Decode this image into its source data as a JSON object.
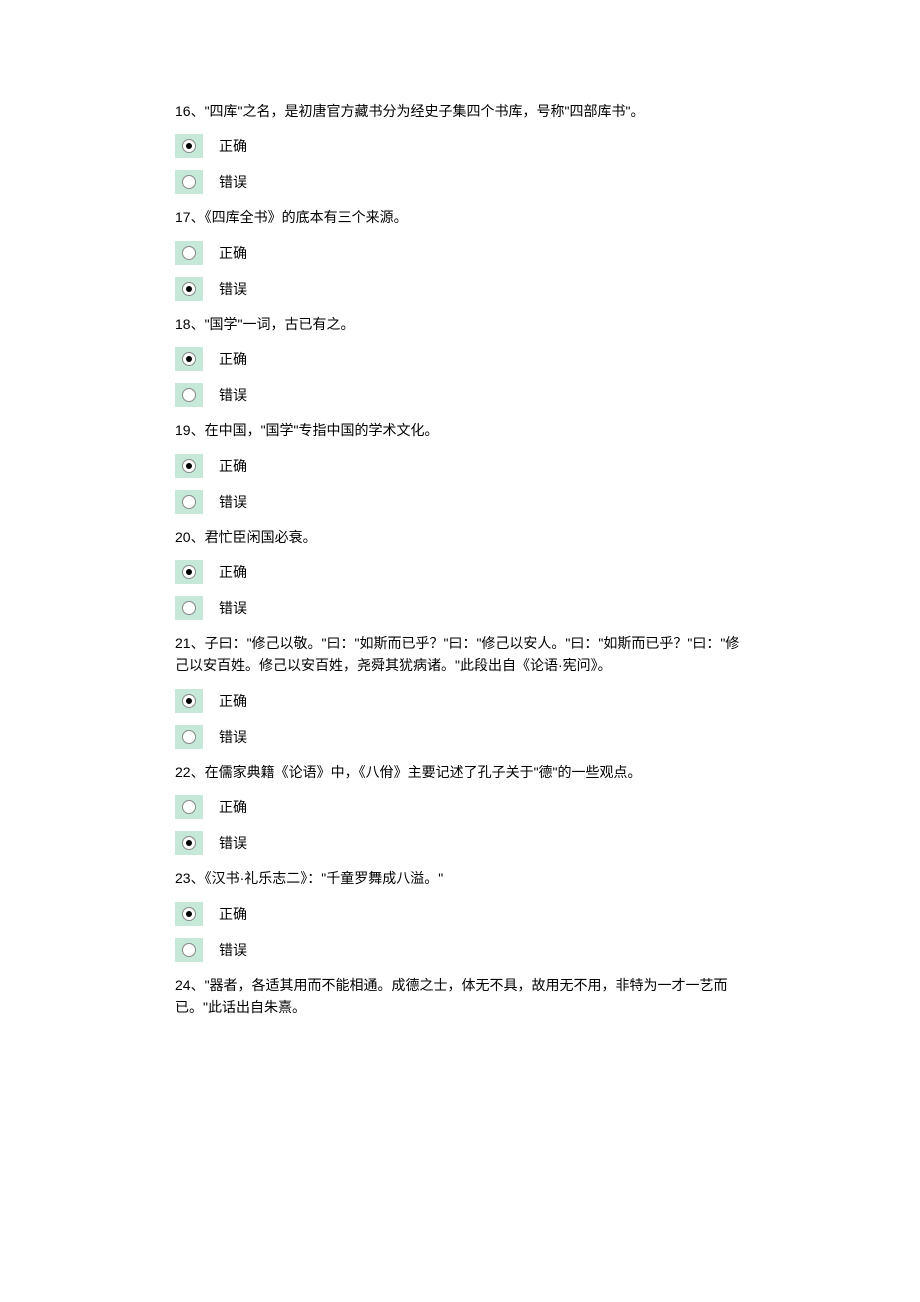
{
  "labels": {
    "correct": "正确",
    "wrong": "错误"
  },
  "questions": [
    {
      "num": "16",
      "text": "\"四库\"之名，是初唐官方藏书分为经史子集四个书库，号称\"四部库书\"。",
      "selected": "correct"
    },
    {
      "num": "17",
      "text": "《四库全书》的底本有三个来源。",
      "selected": "wrong"
    },
    {
      "num": "18",
      "text": "\"国学\"一词，古已有之。",
      "selected": "correct"
    },
    {
      "num": "19",
      "text": "在中国，\"国学\"专指中国的学术文化。",
      "selected": "correct"
    },
    {
      "num": "20",
      "text": "君忙臣闲国必衰。",
      "selected": "correct"
    },
    {
      "num": "21",
      "text": "子曰：\"修己以敬。\"曰：\"如斯而已乎？\"曰：\"修己以安人。\"曰：\"如斯而已乎？\"曰：\"修己以安百姓。修己以安百姓，尧舜其犹病诸。\"此段出自《论语·宪问》。",
      "selected": "correct"
    },
    {
      "num": "22",
      "text": "在儒家典籍《论语》中，《八佾》主要记述了孔子关于\"德\"的一些观点。",
      "selected": "wrong"
    },
    {
      "num": "23",
      "text": "《汉书·礼乐志二》：\"千童罗舞成八溢。\"",
      "selected": "correct"
    },
    {
      "num": "24",
      "text": "\"器者，各适其用而不能相通。成德之士，体无不具，故用无不用，非特为一才一艺而已。\"此话出自朱熹。",
      "selected": null
    }
  ]
}
